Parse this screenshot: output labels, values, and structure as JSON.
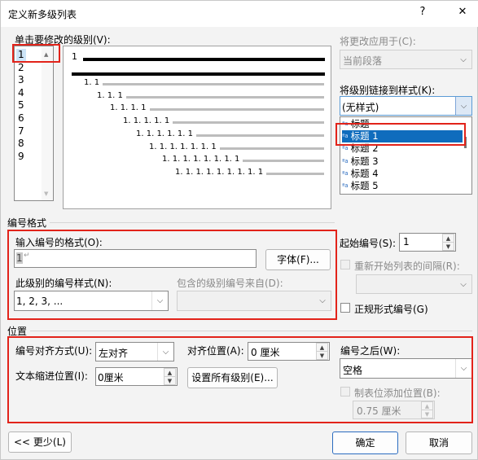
{
  "window": {
    "title": "定义新多级列表",
    "help": "?",
    "close": "✕"
  },
  "level_list": {
    "label": "单击要修改的级别(V):",
    "items": [
      "1",
      "2",
      "3",
      "4",
      "5",
      "6",
      "7",
      "8",
      "9"
    ],
    "selected_index": 0
  },
  "preview": {
    "top_number": "1",
    "rows": [
      "1. 1",
      "1. 1. 1",
      "1. 1. 1. 1",
      "1. 1. 1. 1. 1",
      "1. 1. 1. 1. 1. 1",
      "1. 1. 1. 1. 1. 1. 1",
      "1. 1. 1. 1. 1. 1. 1. 1",
      "1. 1. 1. 1. 1. 1. 1. 1. 1"
    ]
  },
  "apply_to": {
    "label": "将更改应用于(C):",
    "value": "当前段落"
  },
  "link_style": {
    "label": "将级别链接到样式(K):",
    "value": "(无样式)",
    "items": [
      "标题",
      "标题 1",
      "标题 2",
      "标题 3",
      "标题 4",
      "标题 5"
    ],
    "selected_index": 1
  },
  "number_format": {
    "section": "编号格式",
    "input_label": "输入编号的格式(O):",
    "input_value": "1",
    "font_button": "字体(F)...",
    "style_label": "此级别的编号样式(N):",
    "style_value": "1, 2, 3, ...",
    "include_label": "包含的级别编号来自(D):",
    "include_value": ""
  },
  "start": {
    "label": "起始编号(S):",
    "value": "1",
    "restart_label": "重新开始列表的间隔(R):",
    "legal_label": "正规形式编号(G)"
  },
  "position": {
    "section": "位置",
    "align_label": "编号对齐方式(U):",
    "align_value": "左对齐",
    "align_at_label": "对齐位置(A):",
    "align_at_value": "0 厘米",
    "indent_label": "文本缩进位置(I):",
    "indent_value": "0厘米",
    "set_all_button": "设置所有级别(E)...",
    "follow_label": "编号之后(W):",
    "follow_value": "空格",
    "tab_label": "制表位添加位置(B):",
    "tab_value": "0.75 厘米"
  },
  "footer": {
    "less": "<< 更少(L)",
    "ok": "确定",
    "cancel": "取消"
  }
}
